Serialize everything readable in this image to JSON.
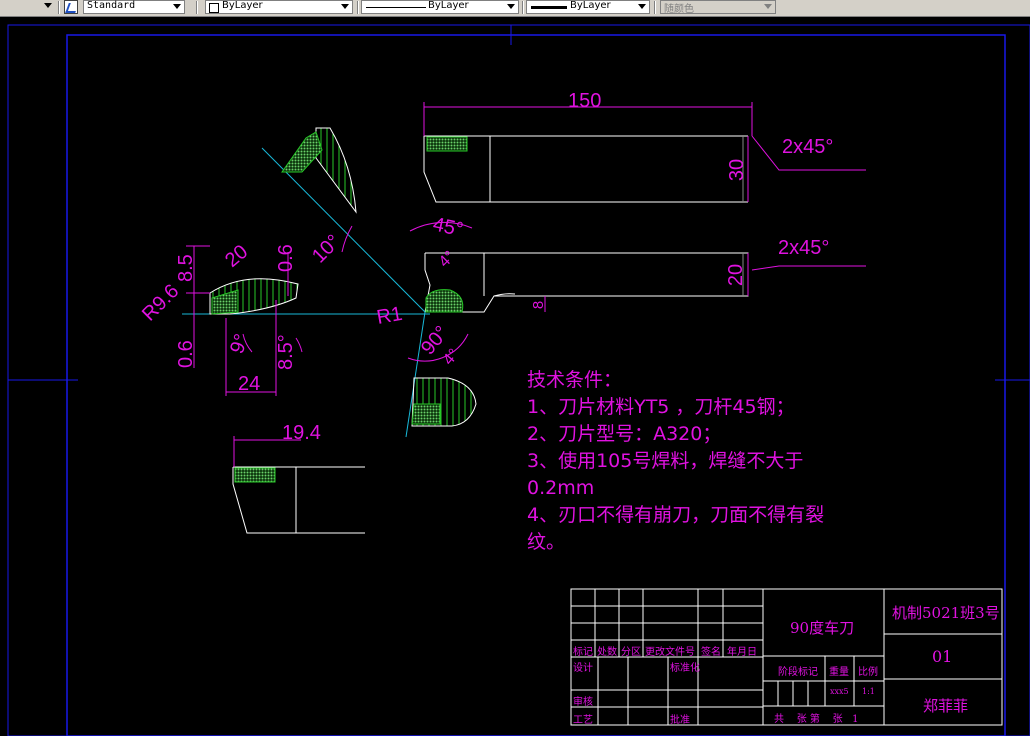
{
  "toolbar": {
    "text_style": "Standard",
    "layer": "ByLayer",
    "linetype": "ByLayer",
    "lineweight": "ByLayer",
    "plot_style": "随颜色"
  },
  "drawing": {
    "dimensions": {
      "length": "150",
      "height_top": "30",
      "height_mid": "20",
      "chamfer_top": "2x45°",
      "chamfer_mid": "2x45°",
      "step": "8",
      "insert_width": "19.4",
      "angle_10": "10°",
      "angle_45": "45°",
      "angle_90": "90°",
      "angle_4": "4°",
      "angle_r": "R1",
      "r96": "R9.6",
      "d85": "8.5",
      "d20": "20",
      "d06_top": "0.6",
      "d06_left": "0.6",
      "a9": "9°",
      "a85": "8.5°",
      "d24": "24"
    },
    "notes": {
      "heading": "技术条件：",
      "line1": "1、刀片材料YT5 ，刀杆45钢；",
      "line2": "2、刀片型号：A320；",
      "line3": "3、使用105号焊料，焊缝不大于",
      "line3b": "0.2mm",
      "line4": "4、刃口不得有崩刀，刀面不得有裂",
      "line4b": "纹。"
    },
    "title_block": {
      "part_name": "90度车刀",
      "class_label": "机制5021班3号",
      "drawing_no": "01",
      "author": "郑菲菲",
      "h_biaoji": "标记",
      "h_chushu": "处数",
      "h_fenqu": "分区",
      "h_gengai": "更改文件号",
      "h_qianming": "签名",
      "h_nianyueri": "年月日",
      "h_sheji": "设计",
      "h_biaozhunhua": "标准化",
      "h_shenhe": "审核",
      "h_gongyi": "工艺",
      "h_pizhun": "批准",
      "h_jieduan": "阶段标记",
      "h_zhongliang": "重量",
      "h_bili": "比例",
      "v_weight": "xxx5",
      "v_scale": "1:1",
      "sheet_text": "共    张 第    张   1"
    }
  },
  "colors": {
    "background": "#000000",
    "object": "#ffffff",
    "dimension": "#e012e0",
    "center": "#18b8d8",
    "border": "#1818e8",
    "hatch_green": "#28c828",
    "fill_green": "#6ad06a"
  }
}
